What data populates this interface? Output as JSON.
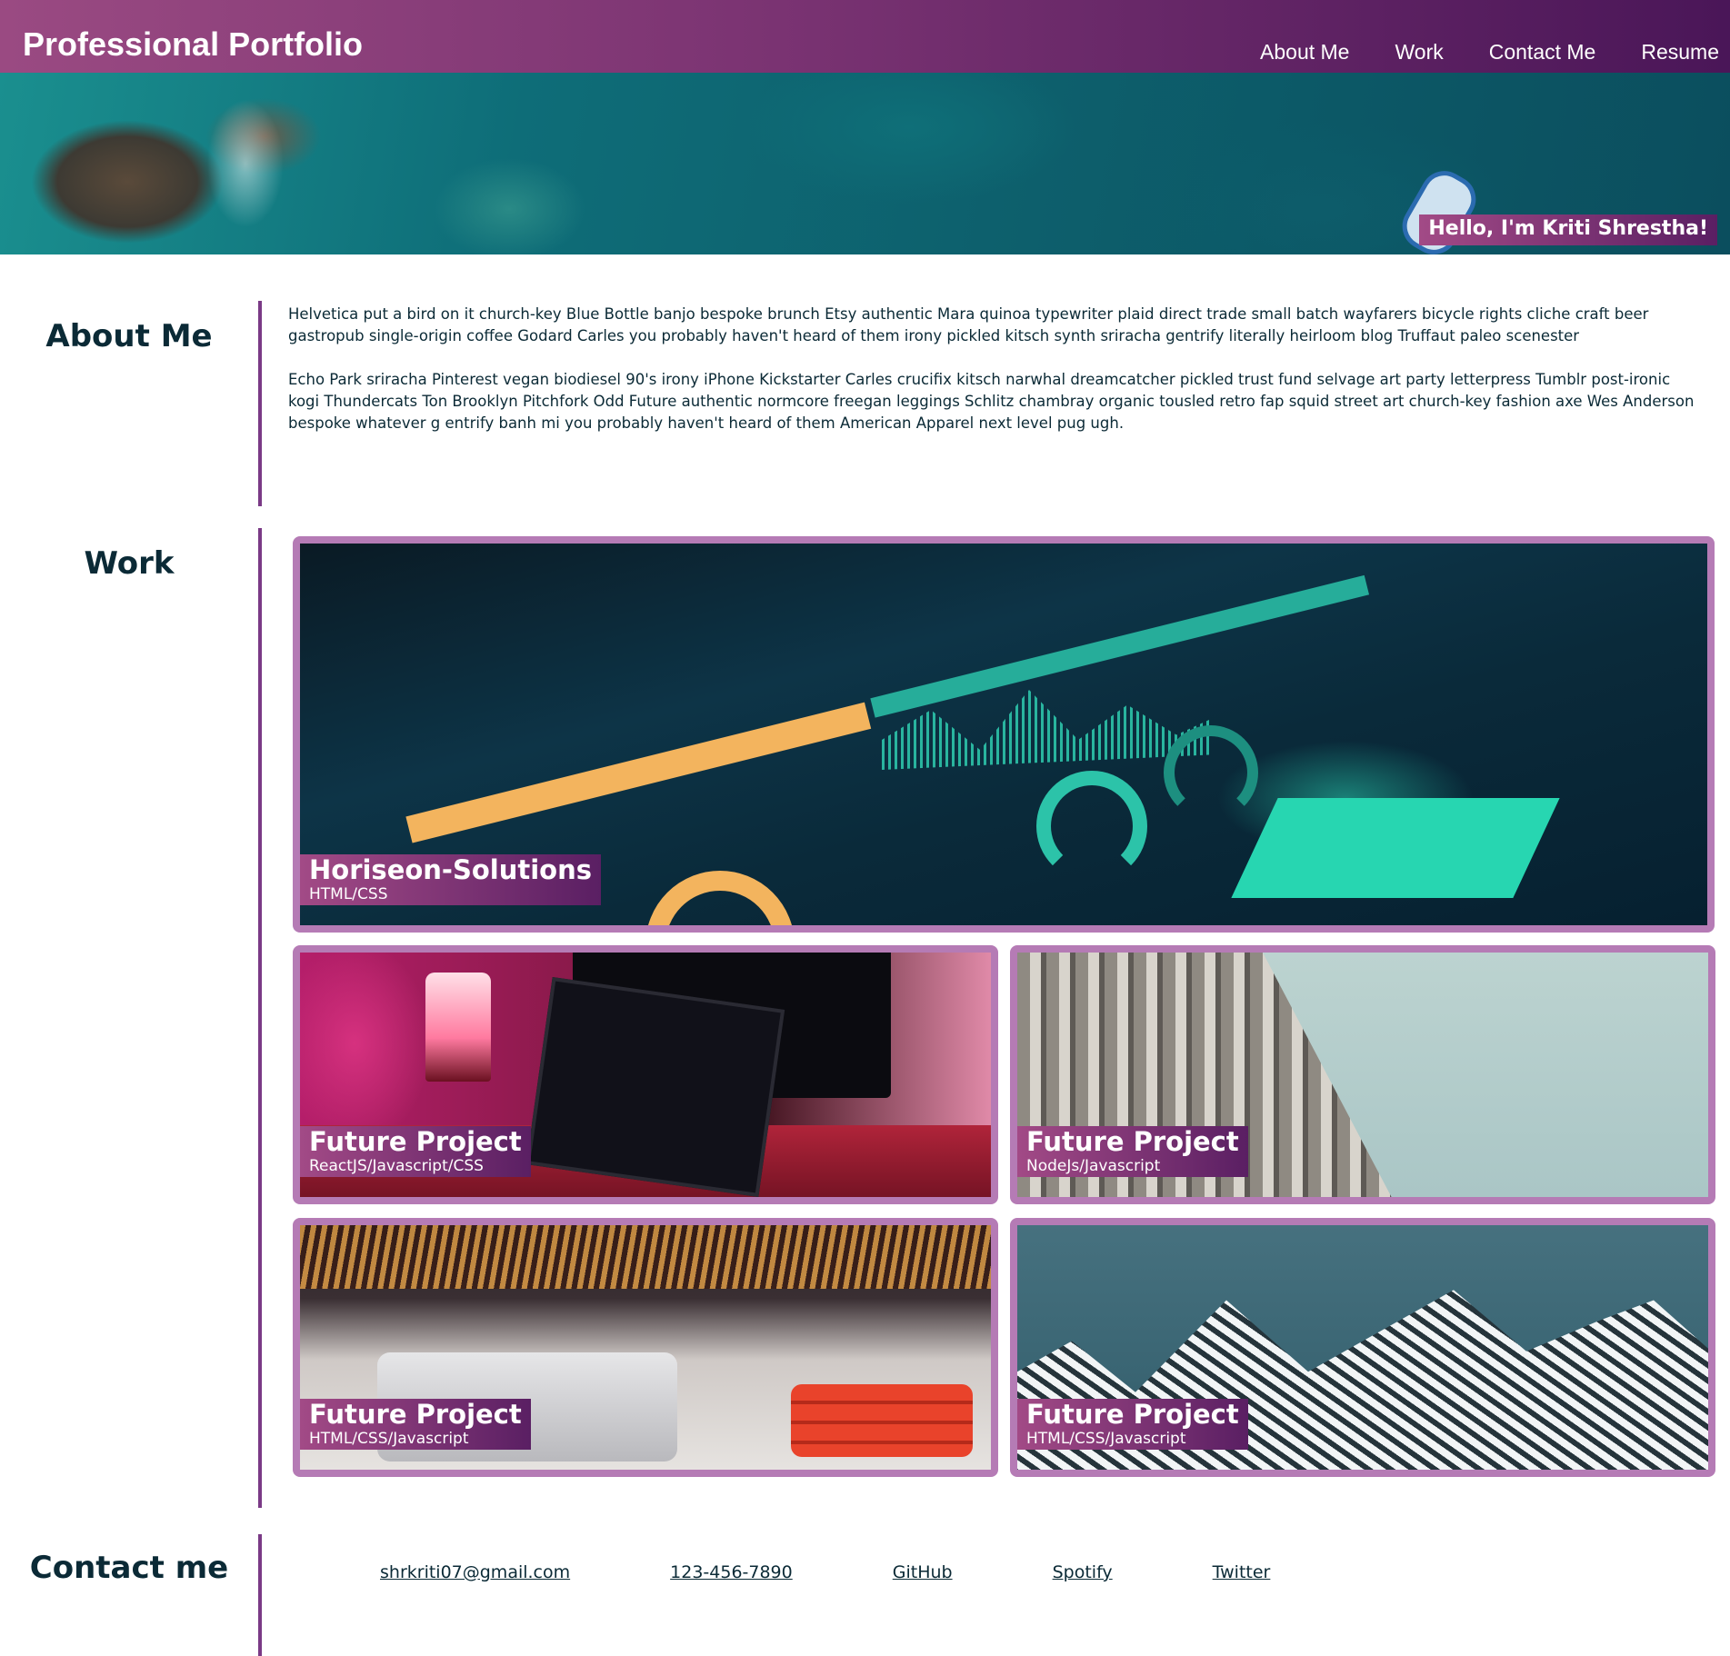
{
  "header": {
    "brand": "Professional Portfolio",
    "nav": [
      {
        "label": "About Me"
      },
      {
        "label": "Work"
      },
      {
        "label": "Contact Me"
      },
      {
        "label": "Resume"
      }
    ]
  },
  "hero": {
    "greeting": "Hello, I'm Kriti Shrestha!"
  },
  "about": {
    "title": "About Me",
    "paragraphs": [
      "Helvetica put a bird on it church-key Blue Bottle banjo bespoke brunch Etsy authentic Mara quinoa typewriter plaid direct trade small batch wayfarers bicycle rights cliche craft beer gastropub single-origin coffee Godard Carles you probably haven't heard of them irony pickled kitsch synth sriracha gentrify literally heirloom blog Truffaut paleo scenester",
      "Echo Park sriracha Pinterest vegan biodiesel 90's irony iPhone Kickstarter Carles crucifix kitsch narwhal dreamcatcher pickled trust fund selvage art party letterpress Tumblr post-ironic kogi Thundercats Ton Brooklyn Pitchfork Odd Future authentic normcore freegan leggings Schlitz chambray organic tousled retro fap squid street art church-key fashion axe Wes Anderson bespoke whatever g entrify banh mi you probably haven't heard of them American Apparel next level pug ugh."
    ]
  },
  "work": {
    "title": "Work",
    "projects": [
      {
        "name": "Horiseon-Solutions",
        "tech": "HTML/CSS"
      },
      {
        "name": "Future Project",
        "tech": "ReactJS/Javascript/CSS"
      },
      {
        "name": "Future Project",
        "tech": "NodeJs/Javascript"
      },
      {
        "name": "Future Project",
        "tech": "HTML/CSS/Javascript"
      },
      {
        "name": "Future Project",
        "tech": "HTML/CSS/Javascript"
      }
    ]
  },
  "contact": {
    "title": "Contact me",
    "links": [
      {
        "label": "shrkriti07@gmail.com"
      },
      {
        "label": "123-456-7890"
      },
      {
        "label": "GitHub"
      },
      {
        "label": "Spotify"
      },
      {
        "label": "Twitter"
      }
    ]
  },
  "colors": {
    "accent": "#7a3a86",
    "card_border": "#b57bb5",
    "heading": "#0b2a36"
  }
}
